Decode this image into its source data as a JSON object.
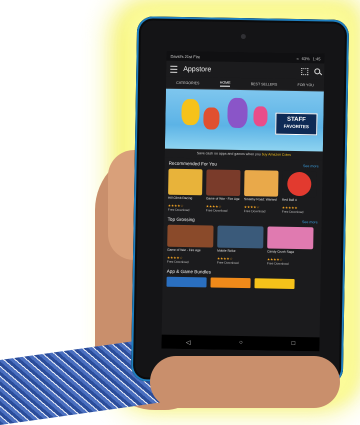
{
  "status": {
    "owner": "David's 21st Fire",
    "battery": "63%",
    "time": "1:45"
  },
  "appbar": {
    "title": "Appstore"
  },
  "tabs": [
    "CATEGORIES",
    "HOME",
    "BEST SELLERS",
    "FOR YOU"
  ],
  "banner": {
    "line1": "STAFF",
    "line2": "FAVORITES"
  },
  "promo": {
    "text": "Save cash on apps and games when you ",
    "link": "buy Amazon Coins"
  },
  "recommended": {
    "title": "Recommended For You",
    "see_more": "See more",
    "items": [
      {
        "title": "Hill Climb Racing",
        "stars": "★★★★☆",
        "price": "Free Download",
        "color": "#e8b33a"
      },
      {
        "title": "Game of War - Fire Age",
        "stars": "★★★★☆",
        "price": "Free Download",
        "color": "#7a3b2a"
      },
      {
        "title": "Smashy Road: Wanted",
        "stars": "★★★★☆",
        "price": "Free Download",
        "color": "#e9a94a"
      },
      {
        "title": "Red Ball 4",
        "stars": "★★★★★",
        "price": "Free Download",
        "color": "#e23a2f"
      }
    ]
  },
  "topgrossing": {
    "title": "Top Grossing",
    "see_more": "See more",
    "items": [
      {
        "title": "Game of War - Fire Age",
        "stars": "★★★★☆",
        "price": "Free Download",
        "color": "#8a4a2a"
      },
      {
        "title": "Mobile Strike",
        "stars": "★★★★☆",
        "price": "Free Download",
        "color": "#3a5a7a"
      },
      {
        "title": "Candy Crush Saga",
        "stars": "★★★★☆",
        "price": "Free Download",
        "color": "#e07ab0"
      }
    ]
  },
  "bundles": {
    "title": "App & Game Bundles",
    "items": [
      {
        "color": "#2a6fc0"
      },
      {
        "color": "#f08a1a"
      },
      {
        "color": "#f6c21a"
      }
    ]
  },
  "nav": {
    "back": "◁",
    "home": "○",
    "recent": "□"
  }
}
